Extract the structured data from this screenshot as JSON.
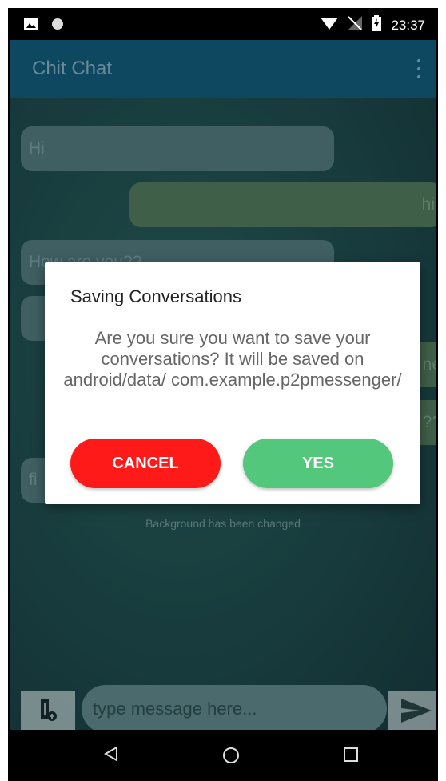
{
  "status_bar": {
    "time": "23:37",
    "icons": [
      "image-icon",
      "circle-icon",
      "wifi-icon",
      "no-sim-icon",
      "battery-charging-icon"
    ]
  },
  "app_bar": {
    "title": "Chit Chat",
    "menu_icon": "overflow-menu-icon"
  },
  "messages": [
    {
      "text": "Hi",
      "direction": "incoming"
    },
    {
      "text": "hi",
      "direction": "outgoing"
    },
    {
      "text": "How are you??",
      "direction": "incoming"
    },
    {
      "text": "",
      "direction": "incoming"
    },
    {
      "text": "ne",
      "direction": "outgoing"
    },
    {
      "text": "??",
      "direction": "outgoing"
    },
    {
      "text": "fi",
      "direction": "incoming"
    }
  ],
  "background_notice": "Background has been changed",
  "composer": {
    "placeholder": "type message here...",
    "attach_icon": "attach-file-icon",
    "send_icon": "send-icon"
  },
  "dialog": {
    "title": "Saving Conversations",
    "message": "Are you sure you want to save your conversations? It will be saved on android/data/ com.example.p2pmessenger/",
    "cancel_label": "CANCEL",
    "yes_label": "YES",
    "colors": {
      "cancel": "#ff1a1a",
      "yes": "#53c77c"
    }
  },
  "nav_bar": {
    "icons": [
      "back-icon",
      "home-icon",
      "recents-icon"
    ]
  }
}
